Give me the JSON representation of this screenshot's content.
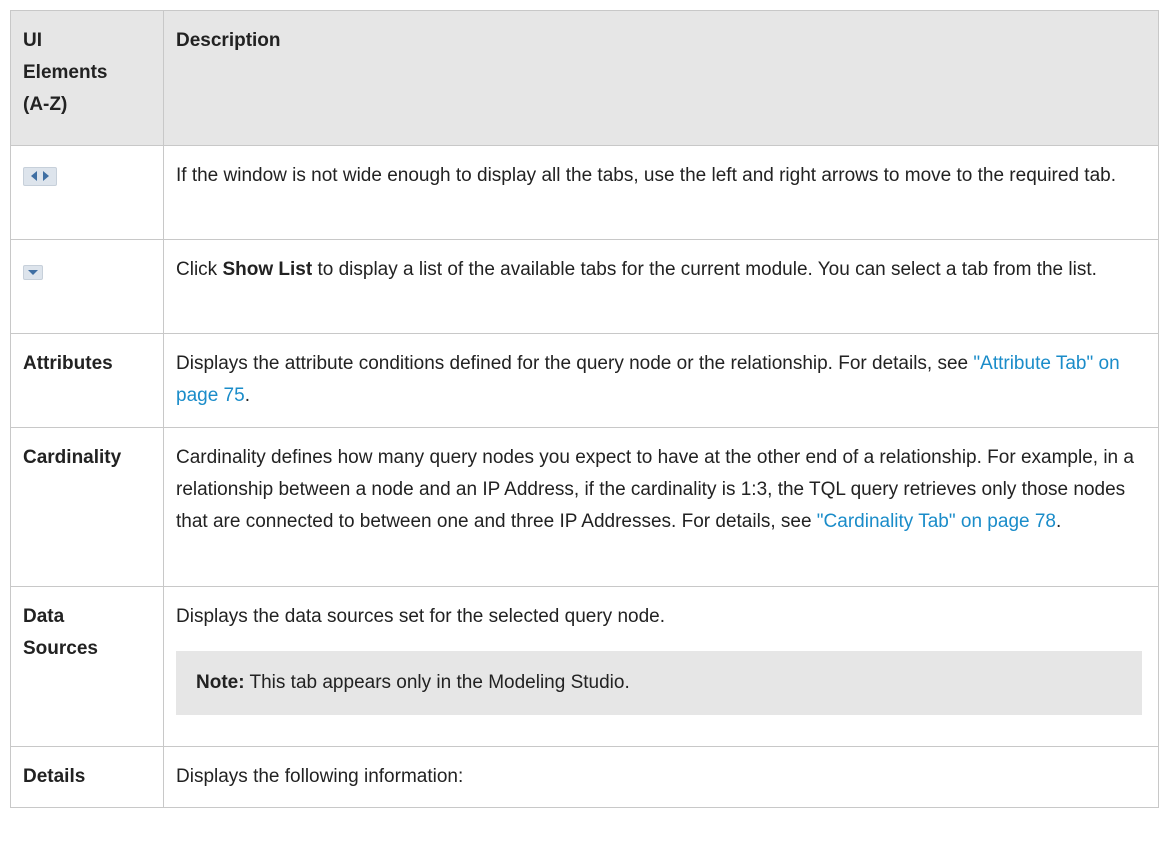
{
  "table": {
    "headers": {
      "col1_lines": [
        "UI",
        "Elements",
        "(A-Z)"
      ],
      "col2": "Description"
    },
    "rows": {
      "arrows": {
        "icon": "left-right-arrows-icon",
        "description": "If the window is not wide enough to display all the tabs, use the left and right arrows to move to the required tab."
      },
      "show_list": {
        "icon": "dropdown-arrow-icon",
        "desc_prefix": "Click ",
        "desc_bold": "Show List",
        "desc_suffix": " to display a list of the available tabs for the current module. You can select a tab from the list."
      },
      "attributes": {
        "label": "Attributes",
        "desc_prefix": "Displays the attribute conditions defined for the query node or the relationship. For details, see ",
        "link": "\"Attribute Tab\" on page 75",
        "desc_suffix": "."
      },
      "cardinality": {
        "label": "Cardinality",
        "desc_prefix": "Cardinality defines how many query nodes you expect to have at the other end of a relationship. For example, in a relationship between a node and an IP Address, if the cardinality is 1:3, the TQL query retrieves only those nodes that are connected to between one and three IP Addresses. For details, see ",
        "link": "\"Cardinality Tab\" on page 78",
        "desc_suffix": "."
      },
      "data_sources": {
        "label_lines": [
          "Data",
          "Sources"
        ],
        "description": "Displays the data sources set for the selected query node.",
        "note_label": "Note:",
        "note_text": " This tab appears only in the Modeling Studio."
      },
      "details": {
        "label": "Details",
        "description": "Displays the following information:"
      }
    }
  },
  "colors": {
    "link": "#1a8cc9",
    "header_bg": "#e6e6e6",
    "note_bg": "#e6e6e6",
    "border": "#c8c8c8"
  }
}
